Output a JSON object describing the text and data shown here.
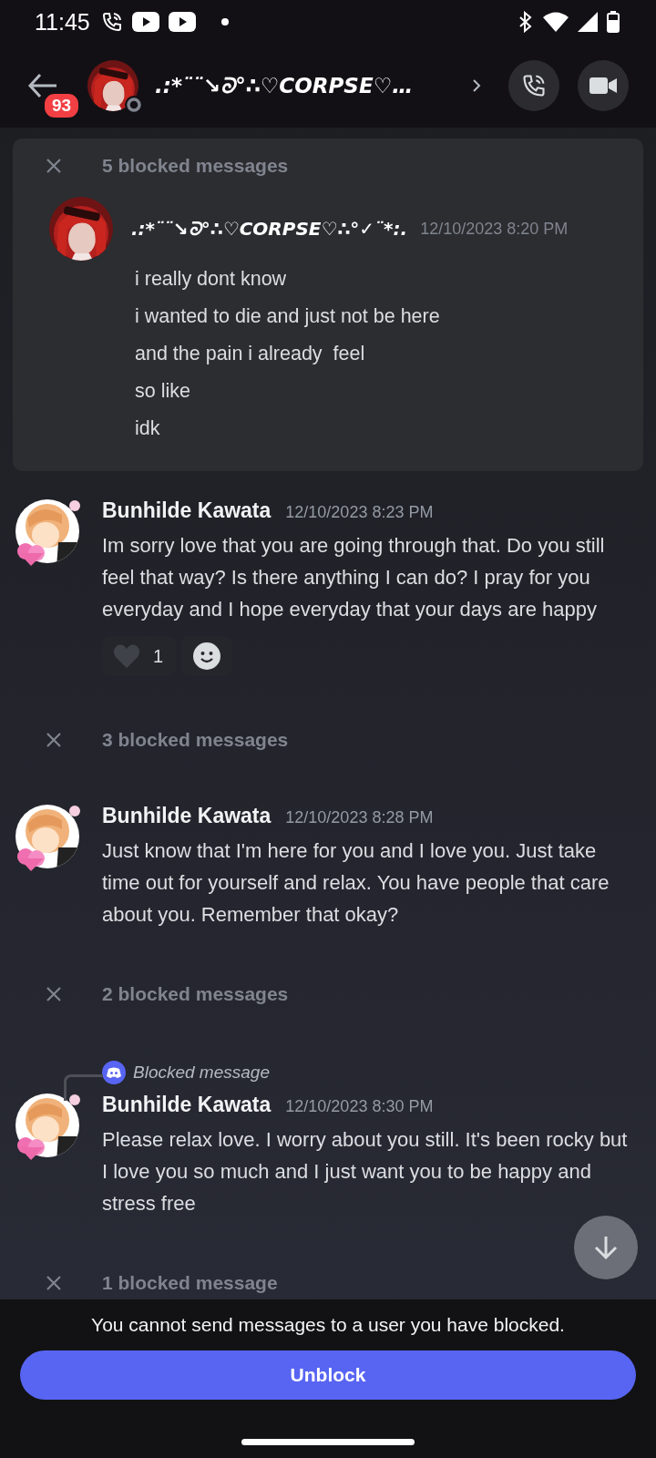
{
  "status_bar": {
    "time": "11:45"
  },
  "header": {
    "unread_badge": "93",
    "title": ".:*¨¨↘ᘐ°∴♡CORPSE♡…"
  },
  "feed": [
    {
      "kind": "blocked",
      "label": "5 blocked messages",
      "expanded": true,
      "messages": [
        {
          "author": ".:*¨¨↘ᘐ°∴♡CORPSE♡∴°✓¨*:.",
          "timestamp": "12/10/2023 8:20 PM",
          "lines": [
            "i really dont know",
            "i wanted to die and just not be here",
            "and the pain i already  feel",
            "so like",
            "idk"
          ]
        }
      ]
    },
    {
      "kind": "message",
      "author": "Bunhilde Kawata",
      "timestamp": "12/10/2023 8:23 PM",
      "text": "Im sorry love that you are going through that. Do you still feel that way? Is there anything I can do? I pray for you everyday and I hope everyday that your days are happy",
      "reactions": [
        {
          "kind": "heart",
          "count": "1"
        },
        {
          "kind": "add"
        }
      ]
    },
    {
      "kind": "blocked",
      "label": "3 blocked messages",
      "expanded": false
    },
    {
      "kind": "message",
      "author": "Bunhilde Kawata",
      "timestamp": "12/10/2023 8:28 PM",
      "text": "Just know that I'm here for you and I love you. Just take time out for yourself and relax. You have people that care about you. Remember that okay?"
    },
    {
      "kind": "blocked",
      "label": "2 blocked messages",
      "expanded": false
    },
    {
      "kind": "message",
      "author": "Bunhilde Kawata",
      "timestamp": "12/10/2023 8:30 PM",
      "reply_to": "Blocked message",
      "text": "Please relax love. I worry about you still. It's been rocky but I love you so much and I just want you to be happy and stress free"
    },
    {
      "kind": "blocked",
      "label": "1 blocked message",
      "expanded": false
    }
  ],
  "footer": {
    "notice": "You cannot send messages to a user you have blocked.",
    "button": "Unblock"
  }
}
